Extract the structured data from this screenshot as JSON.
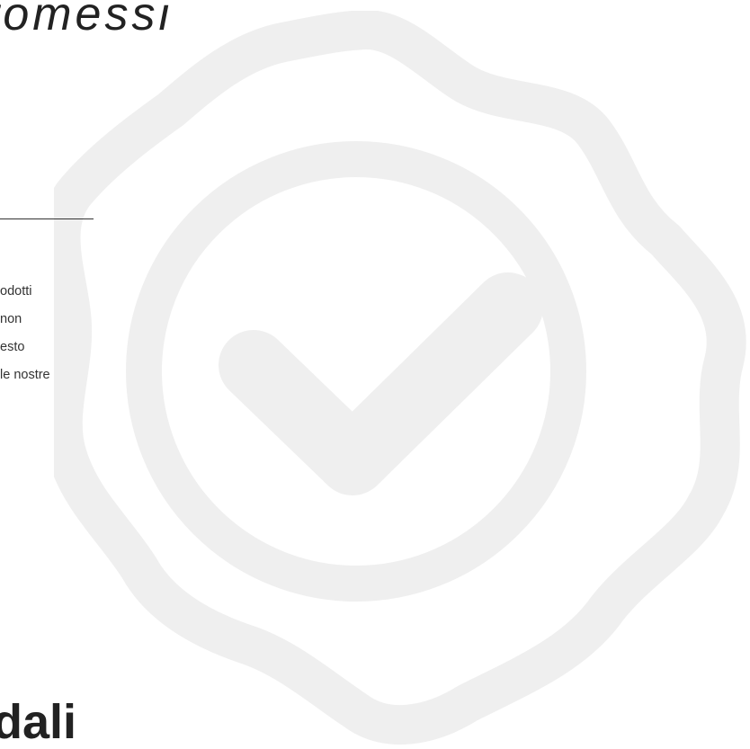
{
  "header": {
    "title": "romessi"
  },
  "body": {
    "lines": [
      "odotti",
      "non",
      "esto",
      "le nostre"
    ]
  },
  "footer": {
    "title": "dali"
  },
  "badge": {
    "icon": "verified-check-badge-icon",
    "color": "#efefef"
  }
}
